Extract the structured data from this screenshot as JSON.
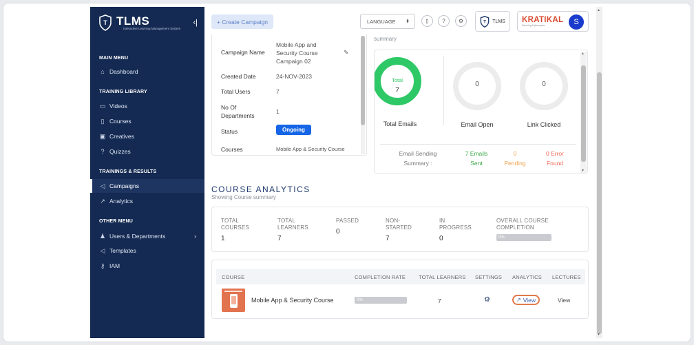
{
  "sidebar": {
    "logo_title": "TLMS",
    "logo_sub": "Interactive Learning Management System",
    "sections": {
      "main": "MAIN MENU",
      "training": "TRAINING LIBRARY",
      "results": "TRAININGS & RESULTS",
      "other": "OTHER MENU"
    },
    "items": {
      "dashboard": "Dashboard",
      "videos": "Videos",
      "courses": "Courses",
      "creatives": "Creatives",
      "quizzes": "Quizzes",
      "campaigns": "Campaigns",
      "analytics": "Analytics",
      "users": "Users & Departments",
      "templates": "Templates",
      "iam": "IAM"
    }
  },
  "topbar": {
    "create_campaign": "+ Create Campaign",
    "language": "LANGUAGE",
    "tlms_badge": "TLMS",
    "brand": "KRATIKAL",
    "brand_sub": "Securing Cyberspace",
    "avatar_letter": "S"
  },
  "campaign_info": {
    "name_label": "Campaign Name",
    "name_value": "Mobile App and Security Course Campaign 02",
    "created_label": "Created Date",
    "created_value": "24-NOV-2023",
    "users_label": "Total Users",
    "users_value": "7",
    "depts_label": "No Of Departments",
    "depts_value": "1",
    "status_label": "Status",
    "status_value": "Ongoing",
    "courses_label": "Courses",
    "courses_value": "Mobile App & Security Course"
  },
  "email_summary": {
    "header_fragment": "summary",
    "total_inner_label": "Total",
    "total_value": "7",
    "total_label": "Total Emails",
    "open_value": "0",
    "open_label": "Email Open",
    "clicked_value": "0",
    "clicked_label": "Link Clicked",
    "sending_label_1": "Email Sending",
    "sending_label_2": "Summary :",
    "sent_1": "7 Emails",
    "sent_2": "Sent",
    "pending_1": "0",
    "pending_2": "Pending",
    "error_1": "0 Error",
    "error_2": "Found",
    "colors": {
      "ring": "#2ec866",
      "sent": "#3aa847",
      "pending": "#f0a04b",
      "error": "#ee6b5b"
    }
  },
  "course_analytics": {
    "title": "COURSE ANALYTICS",
    "subtitle": "Showing Course summary",
    "stats": {
      "total_courses_label": "TOTAL\nCOURSES",
      "total_courses": "1",
      "total_learners_label": "TOTAL\nLEARNERS",
      "total_learners": "7",
      "passed_label": "PASSED",
      "passed": "0",
      "non_started_label": "NON-\nSTARTED",
      "non_started": "7",
      "in_progress_label": "IN\nPROGRESS",
      "in_progress": "0",
      "overall_label": "OVERALL COURSE\nCOMPLETION",
      "overall": "0%"
    },
    "table": {
      "headers": [
        "COURSE",
        "COMPLETION RATE",
        "TOTAL LEARNERS",
        "SETTINGS",
        "ANALYTICS",
        "LECTURES"
      ],
      "row": {
        "course": "Mobile App & Security Course",
        "completion": "0%",
        "learners": "7",
        "analytics": "View",
        "lectures": "View"
      }
    }
  }
}
